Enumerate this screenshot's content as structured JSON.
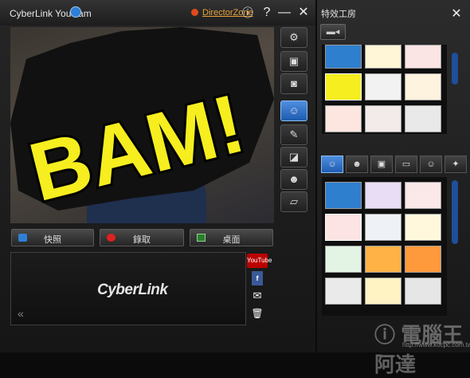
{
  "app": {
    "title": "CyberLink YouCam",
    "director_zone": "DirectorZone"
  },
  "window_buttons": {
    "info": "ⓘ",
    "help": "?",
    "minimize": "—",
    "close": "✕"
  },
  "preview": {
    "overlay_text": "BAM!"
  },
  "capture": {
    "snapshot": "快照",
    "record": "錄取",
    "desktop": "桌面"
  },
  "library": {
    "logo": "CyberLink",
    "collapse": "«",
    "youtube": "YouTube",
    "facebook": "f",
    "email": "✉",
    "delete": "🗑"
  },
  "panel": {
    "title": "特效工房",
    "close": "✕"
  },
  "colors": {
    "accent": "#2e7fd6",
    "bam_yellow": "#f6ee1e",
    "director_link": "#e7a23a"
  },
  "watermark": {
    "main": "ⓘ 電腦王阿達",
    "sub": "http://www.kocpc.com.tw"
  }
}
